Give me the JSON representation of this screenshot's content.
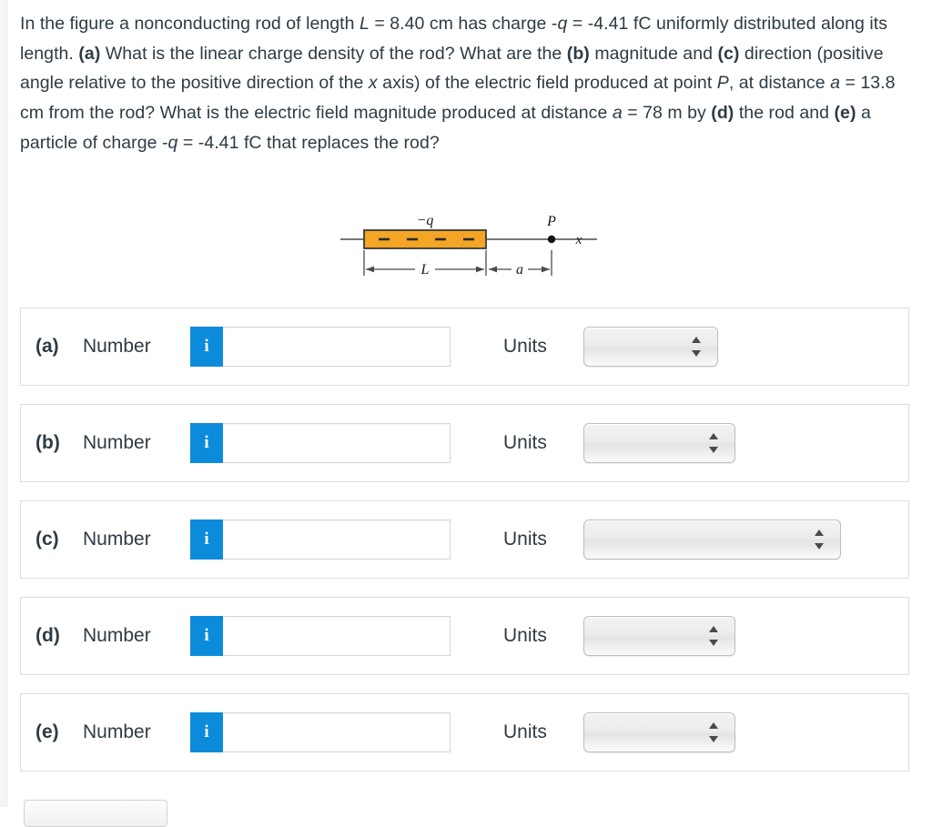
{
  "question": {
    "segments": [
      {
        "t": "In the figure a nonconducting rod of length ",
        "s": "normal"
      },
      {
        "t": "L",
        "s": "italic"
      },
      {
        "t": " = 8.40 cm has charge -",
        "s": "normal"
      },
      {
        "t": "q",
        "s": "italic"
      },
      {
        "t": " = -4.41 fC uniformly distributed along its length. ",
        "s": "normal"
      },
      {
        "t": "(a)",
        "s": "bold"
      },
      {
        "t": " What is the linear charge density of the rod? What are the ",
        "s": "normal"
      },
      {
        "t": "(b)",
        "s": "bold"
      },
      {
        "t": " magnitude and ",
        "s": "normal"
      },
      {
        "t": "(c)",
        "s": "bold"
      },
      {
        "t": " direction (positive angle relative to the positive direction of the ",
        "s": "normal"
      },
      {
        "t": "x",
        "s": "italic"
      },
      {
        "t": " axis) of the electric field produced at point ",
        "s": "normal"
      },
      {
        "t": "P",
        "s": "italic"
      },
      {
        "t": ", at distance ",
        "s": "normal"
      },
      {
        "t": "a",
        "s": "italic"
      },
      {
        "t": " = 13.8 cm from the rod? What is the electric field magnitude produced at distance ",
        "s": "normal"
      },
      {
        "t": "a",
        "s": "italic"
      },
      {
        "t": " = 78 m by ",
        "s": "normal"
      },
      {
        "t": "(d)",
        "s": "bold"
      },
      {
        "t": " the rod and ",
        "s": "normal"
      },
      {
        "t": "(e)",
        "s": "bold"
      },
      {
        "t": " a particle of charge -",
        "s": "normal"
      },
      {
        "t": "q",
        "s": "italic"
      },
      {
        "t": " = -4.41 fC that replaces the rod?",
        "s": "normal"
      }
    ],
    "plain": "In the figure a nonconducting rod of length L = 8.40 cm has charge -q = -4.41 fC uniformly distributed along its length. (a) What is the linear charge density of the rod? What are the (b) magnitude and (c) direction (positive angle relative to the positive direction of the x axis) of the electric field produced at point P, at distance a = 13.8 cm from the rod? What is the electric field magnitude produced at distance a = 78 m by (d) the rod and (e) a particle of charge -q = -4.41 fC that replaces the rod?",
    "given": {
      "L": "8.40 cm",
      "charge": "-4.41 fC",
      "a_part_bc": "13.8 cm",
      "a_part_de": "78 m"
    }
  },
  "figure": {
    "charge_label": "−q",
    "point_label": "P",
    "axis_label": "x",
    "length_label": "L",
    "distance_label": "a",
    "rod_fill": "#F5A623",
    "rod_stroke": "#3a3a3a",
    "minus_count": 4,
    "minus_glyph": "−"
  },
  "rows": [
    {
      "letter": "(a)",
      "number_label": "Number",
      "info_icon": "info-icon",
      "info_glyph": "i",
      "value": "",
      "placeholder": "",
      "units_label": "Units",
      "units_value": "",
      "units_width": 148
    },
    {
      "letter": "(b)",
      "number_label": "Number",
      "info_icon": "info-icon",
      "info_glyph": "i",
      "value": "",
      "placeholder": "",
      "units_label": "Units",
      "units_value": "",
      "units_width": 167
    },
    {
      "letter": "(c)",
      "number_label": "Number",
      "info_icon": "info-icon",
      "info_glyph": "i",
      "value": "",
      "placeholder": "",
      "units_label": "Units",
      "units_value": "",
      "units_width": 283
    },
    {
      "letter": "(d)",
      "number_label": "Number",
      "info_icon": "info-icon",
      "info_glyph": "i",
      "value": "",
      "placeholder": "",
      "units_label": "Units",
      "units_value": "",
      "units_width": 167
    },
    {
      "letter": "(e)",
      "number_label": "Number",
      "info_icon": "info-icon",
      "info_glyph": "i",
      "value": "",
      "placeholder": "",
      "units_label": "Units",
      "units_value": "",
      "units_width": 167
    }
  ],
  "colors": {
    "accent_blue": "#0d8bdb",
    "text": "#2d3b45",
    "row_border": "#dcdcdc",
    "rod_orange": "#F5A623"
  }
}
